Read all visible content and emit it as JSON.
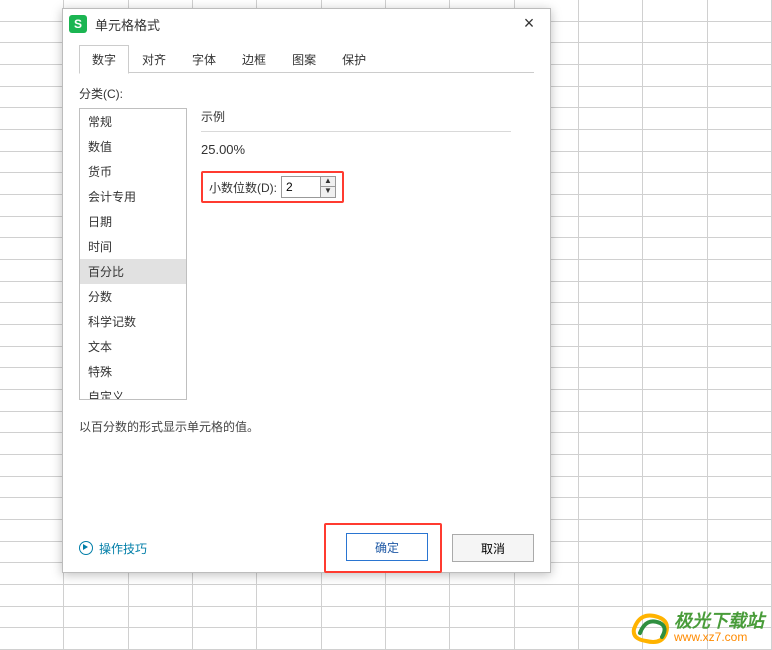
{
  "dialog": {
    "title": "单元格格式",
    "close": "×",
    "tabs": [
      "数字",
      "对齐",
      "字体",
      "边框",
      "图案",
      "保护"
    ],
    "category_label": "分类(C):",
    "categories": [
      "常规",
      "数值",
      "货币",
      "会计专用",
      "日期",
      "时间",
      "百分比",
      "分数",
      "科学记数",
      "文本",
      "特殊",
      "自定义"
    ],
    "selected_category_index": 6,
    "example_label": "示例",
    "example_value": "25.00%",
    "decimal_label": "小数位数(D):",
    "decimal_value": "2",
    "desc": "以百分数的形式显示单元格的值。",
    "tips_label": "操作技巧",
    "ok_label": "确定",
    "cancel_label": "取消"
  },
  "watermark": {
    "title": "极光下载站",
    "url": "www.xz7.com"
  }
}
